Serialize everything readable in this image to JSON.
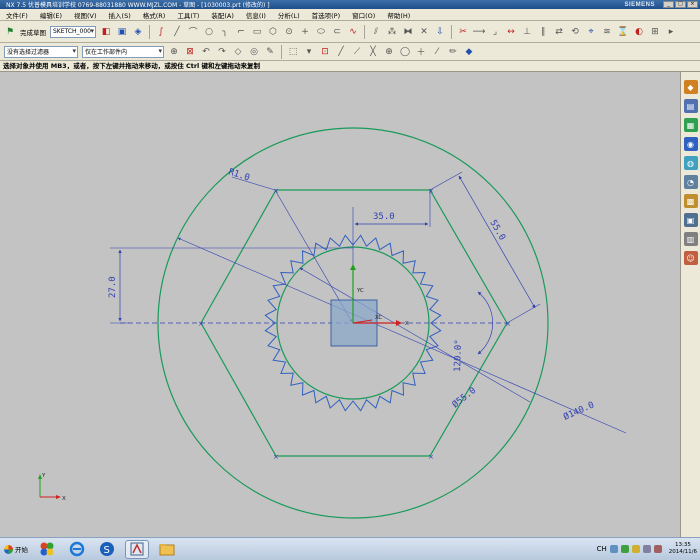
{
  "window": {
    "title": "NX 7.5   优普模具培训学校   0769-88031880   WWW.MJZL.COM - 草图 - [1030003.prt  (修改的)  ]",
    "brand": "SIEMENS",
    "buttons": [
      "_",
      "□",
      "×"
    ]
  },
  "menu": {
    "items": [
      "文件(F)",
      "编辑(E)",
      "视图(V)",
      "插入(S)",
      "格式(R)",
      "工具(T)",
      "装配(A)",
      "信息(I)",
      "分析(L)",
      "首选项(P)",
      "窗口(O)",
      "帮助(H)"
    ]
  },
  "toolbar": {
    "finish_sketch_label": "完成草图",
    "sketch_name": "SKETCH_000",
    "selection_filter": "没有选择过滤器",
    "assembly_scope": "仅在工作部件内"
  },
  "cue_line": "选择对象并使用 MB3，或者，按下左键并拖动来移动，或按住 Ctrl 键和左键拖动来复制",
  "sketch": {
    "dimensions": {
      "radius": "R1.0",
      "width_35": "35.0",
      "side_55": "55.0",
      "height_27": "27.0",
      "angle": "120.0°",
      "inner_dia": "Ø55.0",
      "outer_dia": "Ø140.0"
    },
    "axis_labels": {
      "yc": "YC",
      "xc": "XC",
      "x": "X",
      "y": "Y"
    },
    "colors": {
      "geometry": "#1a9a5a",
      "dimension": "#3040b0",
      "gear": "#3060c0",
      "axis_red": "#d02020",
      "axis_green": "#20a020",
      "background": "#c3c3c3"
    }
  },
  "resource_bar": {
    "icons": [
      "assembly-navigator-icon",
      "constraint-navigator-icon",
      "part-navigator-icon",
      "reuse-library-icon",
      "web-browser-icon",
      "history-icon",
      "system-materials-icon",
      "process-studio-icon",
      "roles-icon",
      "user-icon"
    ]
  },
  "taskbar": {
    "start_label": "开始",
    "apps": [
      "windows-explorer-icon",
      "ie-icon",
      "sogou-icon",
      "nx-icon",
      "folder-icon"
    ],
    "tray_text": "CH",
    "clock_time": "13:35",
    "clock_date": "2014/11/6"
  }
}
